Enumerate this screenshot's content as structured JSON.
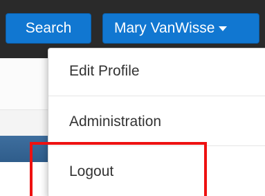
{
  "navbar": {
    "search_label": "Search",
    "user_label": "Mary VanWisse",
    "user_caret_icon": "caret-down-icon"
  },
  "dropdown": {
    "items": [
      {
        "label": "Edit Profile"
      },
      {
        "label": "Administration"
      },
      {
        "label": "Logout"
      }
    ]
  },
  "annotation": {
    "highlight_color": "#ee1111"
  },
  "colors": {
    "button_blue": "#1177d1",
    "navbar_bg": "#2a2a2a",
    "bar_blue": "#2f5d8b"
  }
}
